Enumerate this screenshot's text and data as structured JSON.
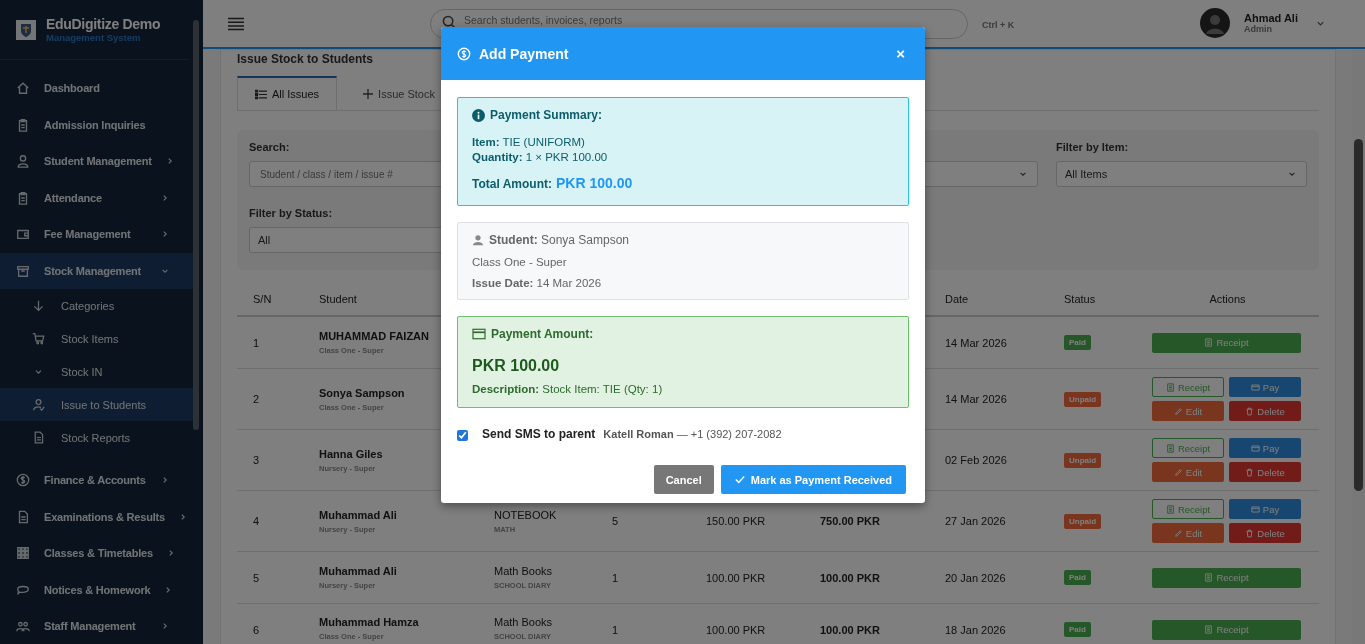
{
  "sidebar": {
    "brand": "EduDigitize Demo",
    "subtitle": "Management System",
    "items": [
      {
        "label": "Dashboard",
        "kind": "link",
        "selected": false
      },
      {
        "label": "Admission Inquiries",
        "kind": "link",
        "selected": false
      },
      {
        "label": "Student Management",
        "kind": "group",
        "expanded": false,
        "selected": false
      },
      {
        "label": "Attendance",
        "kind": "group",
        "expanded": false,
        "selected": false
      },
      {
        "label": "Fee Management",
        "kind": "group",
        "expanded": false,
        "selected": false
      },
      {
        "label": "Stock Management",
        "kind": "group",
        "expanded": true,
        "selected": true,
        "children": [
          {
            "label": "Categories",
            "selected": false
          },
          {
            "label": "Stock Items",
            "selected": false
          },
          {
            "label": "Stock IN",
            "selected": false
          },
          {
            "label": "Issue to Students",
            "selected": true
          },
          {
            "label": "Stock Reports",
            "selected": false
          }
        ]
      },
      {
        "label": "Finance & Accounts",
        "kind": "group",
        "expanded": false,
        "selected": false
      },
      {
        "label": "Examinations & Results",
        "kind": "group",
        "expanded": false,
        "selected": false
      },
      {
        "label": "Classes & Timetables",
        "kind": "group",
        "expanded": false,
        "selected": false
      },
      {
        "label": "Notices & Homework",
        "kind": "group",
        "expanded": false,
        "selected": false
      },
      {
        "label": "Staff Management",
        "kind": "group",
        "expanded": false,
        "selected": false
      }
    ]
  },
  "header": {
    "search": {
      "placeholder": "Search students, invoices, reports"
    },
    "shortcut": "Ctrl + K",
    "user": {
      "name": "Ahmad Ali",
      "role": "Admin"
    }
  },
  "page": {
    "title": "Issue Stock to Students",
    "tabs": [
      {
        "label": "All Issues",
        "selected": true
      },
      {
        "label": "Issue Stock",
        "selected": false
      }
    ],
    "filters": [
      {
        "kind": "text",
        "label": "Search:",
        "placeholder": "Student / class / item / issue #"
      },
      {
        "kind": "select"
      },
      {
        "kind": "select",
        "label": "Filter by Item:",
        "value": "All Items"
      },
      {
        "kind": "select",
        "label": "Filter by Status:",
        "value": "All"
      }
    ]
  },
  "table": {
    "columns": [
      "S/N",
      "Student",
      "Date",
      "Status",
      "Actions"
    ],
    "rows": [
      {
        "sn": "1",
        "student": "MUHAMMAD FAIZAN",
        "class": "Class One - Super",
        "date": "14 Mar 2026",
        "status": "Paid",
        "paid": true,
        "actions": [
          {
            "label": "Receipt",
            "kind": "receipt"
          }
        ]
      },
      {
        "sn": "2",
        "student": "Sonya Sampson",
        "class": "Class One - Super",
        "date": "14 Mar 2026",
        "status": "Unpaid",
        "paid": false,
        "actions": [
          {
            "label": "Receipt",
            "kind": "receipt-outline"
          },
          {
            "label": "Pay",
            "kind": "pay"
          },
          {
            "label": "Edit",
            "kind": "edit"
          },
          {
            "label": "Delete",
            "kind": "delete"
          }
        ]
      },
      {
        "sn": "3",
        "student": "Hanna Giles",
        "class": "Nursery - Super",
        "date": "02 Feb 2026",
        "status": "Unpaid",
        "paid": false,
        "actions": [
          {
            "label": "Receipt",
            "kind": "receipt-outline"
          },
          {
            "label": "Pay",
            "kind": "pay"
          },
          {
            "label": "Edit",
            "kind": "edit"
          },
          {
            "label": "Delete",
            "kind": "delete"
          }
        ]
      },
      {
        "sn": "4",
        "student": "Muhammad Ali",
        "class": "Nursery - Super",
        "item": "NOTEBOOK",
        "category": "MATH",
        "qty": "5",
        "price": "150.00 PKR",
        "total": "750.00 PKR",
        "date": "27 Jan 2026",
        "status": "Unpaid",
        "paid": false,
        "actions": [
          {
            "label": "Receipt",
            "kind": "receipt-outline"
          },
          {
            "label": "Pay",
            "kind": "pay"
          },
          {
            "label": "Edit",
            "kind": "edit"
          },
          {
            "label": "Delete",
            "kind": "delete"
          }
        ]
      },
      {
        "sn": "5",
        "student": "Muhammad Ali",
        "class": "Nursery - Super",
        "item": "Math Books",
        "category": "SCHOOL DIARY",
        "qty": "1",
        "price": "100.00 PKR",
        "total": "100.00 PKR",
        "date": "20 Jan 2026",
        "status": "Paid",
        "paid": true,
        "actions": [
          {
            "label": "Receipt",
            "kind": "receipt"
          }
        ]
      },
      {
        "sn": "6",
        "student": "Muhammad Hamza",
        "class": "Class One - Super",
        "item": "Math Books",
        "category": "SCHOOL DIARY",
        "qty": "1",
        "price": "100.00 PKR",
        "total": "100.00 PKR",
        "date": "18 Jan 2026",
        "status": "Paid",
        "paid": true,
        "actions": [
          {
            "label": "Receipt",
            "kind": "receipt"
          }
        ]
      }
    ]
  },
  "modal": {
    "title": "Add Payment",
    "close": "×",
    "summary": {
      "heading": "Payment Summary:",
      "lines": [
        "**Item:** TIE (UNIFORM)",
        "**Quantity:** 1 × PKR 100.00"
      ],
      "total_label": "Total Amount:",
      "total_value": "PKR 100.00"
    },
    "student": {
      "line": "**Student:** Sonya Sampson",
      "class": "Class One - Super",
      "issue_date": "**Issue Date:** 14 Mar 2026"
    },
    "payment": {
      "heading": "Payment Amount:",
      "amount": "PKR 100.00",
      "description": "**Description:** Stock Item: TIE (Qty: 1)"
    },
    "sms": {
      "label": "Send SMS to parent",
      "checked": true,
      "recipient": "**Katell Roman** — +1 (392) 207-2082"
    },
    "buttons": [
      {
        "label": "Cancel",
        "kind": "secondary"
      },
      {
        "label": "Mark as Payment Received",
        "kind": "primary"
      }
    ]
  }
}
